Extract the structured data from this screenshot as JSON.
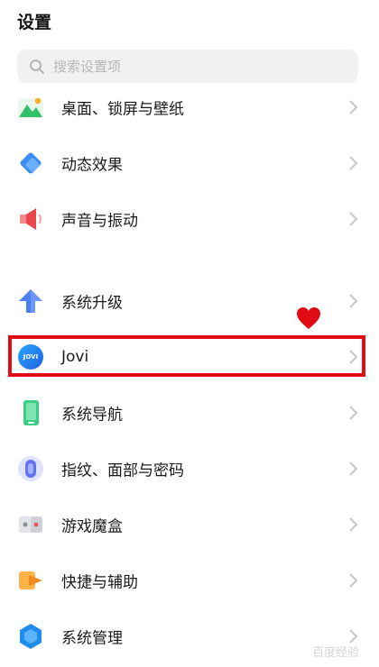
{
  "header": {
    "title": "设置"
  },
  "search": {
    "placeholder": "搜索设置项",
    "icon": "search-icon"
  },
  "items": [
    {
      "label": "桌面、锁屏与壁纸",
      "icon": "wallpaper-icon"
    },
    {
      "label": "动态效果",
      "icon": "dynamic-effect-icon"
    },
    {
      "label": "声音与振动",
      "icon": "sound-icon"
    },
    {
      "label": "系统升级",
      "icon": "upgrade-arrow-icon"
    },
    {
      "label": "Jovi",
      "icon": "jovi-icon",
      "badge_text": "JOVI"
    },
    {
      "label": "系统导航",
      "icon": "navigation-phone-icon"
    },
    {
      "label": "指纹、面部与密码",
      "icon": "fingerprint-icon"
    },
    {
      "label": "游戏魔盒",
      "icon": "game-box-icon"
    },
    {
      "label": "快捷与辅助",
      "icon": "shortcut-icon"
    },
    {
      "label": "系统管理",
      "icon": "system-manage-icon"
    }
  ],
  "colors": {
    "highlight": "#e00b14",
    "heart": "#e00b14",
    "chevron": "#c6c6c8"
  },
  "watermark": {
    "text": "百度经验"
  }
}
